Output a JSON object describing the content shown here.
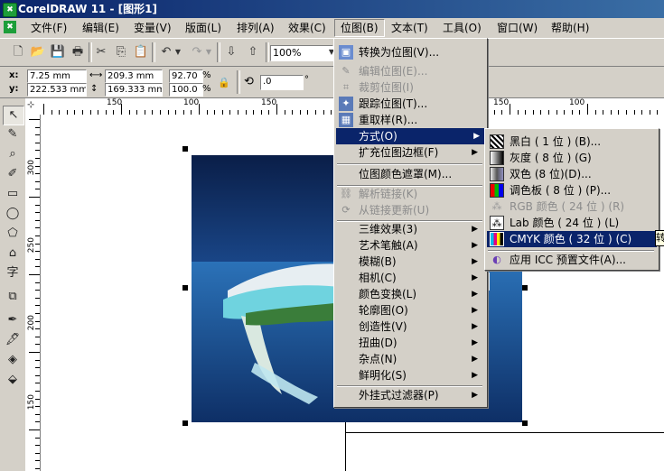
{
  "title": "CorelDRAW 11 - [图形1]",
  "menubar": [
    "文件(F)",
    "编辑(E)",
    "变量(V)",
    "版面(L)",
    "排列(A)",
    "效果(C)",
    "位图(B)",
    "文本(T)",
    "工具(O)",
    "窗口(W)",
    "帮助(H)"
  ],
  "toolbar": {
    "zoom": "100%"
  },
  "propbar": {
    "x_label": "x:",
    "x": "7.25 mm",
    "y_label": "y:",
    "y": "222.533 mm",
    "w": "209.3 mm",
    "h": "169.333 mm",
    "sx": "92.70",
    "sy": "100.0",
    "pct1": "%",
    "pct2": "%",
    "angle": ".0",
    "deg": "°"
  },
  "hruler_labels": [
    "150",
    "100",
    "150",
    "150",
    "100"
  ],
  "vruler_labels": [
    "300",
    "250",
    "200",
    "150"
  ],
  "bitmap_menu": {
    "items": [
      {
        "label": "转换为位图(V)...",
        "state": "normal",
        "icon": "convert-icon"
      },
      {
        "label": "编辑位图(E)...",
        "state": "disabled",
        "icon": "edit-bitmap-icon"
      },
      {
        "label": "裁剪位图(I)",
        "state": "disabled",
        "icon": "crop-icon"
      },
      {
        "label": "跟踪位图(T)...",
        "state": "normal",
        "icon": "trace-icon"
      },
      {
        "label": "重取样(R)...",
        "state": "normal",
        "icon": "resample-icon"
      },
      {
        "label": "方式(O)",
        "state": "highlight",
        "submenu": true
      },
      {
        "label": "扩充位图边框(F)",
        "state": "normal",
        "submenu": true
      },
      {
        "label": "位图颜色遮罩(M)...",
        "state": "normal"
      },
      {
        "label": "解析链接(K)",
        "state": "disabled",
        "icon": "link-icon"
      },
      {
        "label": "从链接更新(U)",
        "state": "disabled",
        "icon": "update-link-icon"
      },
      {
        "label": "三维效果(3)",
        "state": "normal",
        "submenu": true
      },
      {
        "label": "艺术笔触(A)",
        "state": "normal",
        "submenu": true
      },
      {
        "label": "模糊(B)",
        "state": "normal",
        "submenu": true
      },
      {
        "label": "相机(C)",
        "state": "normal",
        "submenu": true
      },
      {
        "label": "颜色变换(L)",
        "state": "normal",
        "submenu": true
      },
      {
        "label": "轮廓图(O)",
        "state": "normal",
        "submenu": true
      },
      {
        "label": "创造性(V)",
        "state": "normal",
        "submenu": true
      },
      {
        "label": "扭曲(D)",
        "state": "normal",
        "submenu": true
      },
      {
        "label": "杂点(N)",
        "state": "normal",
        "submenu": true
      },
      {
        "label": "鲜明化(S)",
        "state": "normal",
        "submenu": true
      },
      {
        "label": "外挂式过滤器(P)",
        "state": "normal",
        "submenu": true
      }
    ]
  },
  "mode_submenu": {
    "items": [
      {
        "label": "黑白 ( 1 位 ) (B)...",
        "state": "normal",
        "icon": "bw-icon"
      },
      {
        "label": "灰度 ( 8 位 ) (G)",
        "state": "normal",
        "icon": "grayscale-icon"
      },
      {
        "label": "双色 (8 位)(D)...",
        "state": "normal",
        "icon": "duotone-icon"
      },
      {
        "label": "调色板 ( 8 位 ) (P)...",
        "state": "normal",
        "icon": "palette-icon"
      },
      {
        "label": "RGB 颜色 ( 24 位 ) (R)",
        "state": "disabled",
        "icon": "rgb-icon"
      },
      {
        "label": "Lab 颜色 ( 24 位 ) (L)",
        "state": "normal",
        "icon": "lab-icon"
      },
      {
        "label": "CMYK 颜色 ( 32 位 ) (C)",
        "state": "highlight",
        "icon": "cmyk-icon"
      },
      {
        "label": "应用 ICC 预置文件(A)...",
        "state": "normal",
        "icon": "icc-icon"
      }
    ]
  },
  "tooltip_glyph": "转"
}
